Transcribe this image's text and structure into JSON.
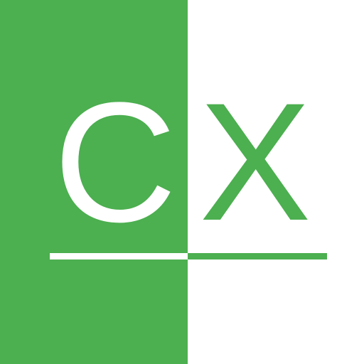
{
  "logo": {
    "letter_left": "C",
    "letter_right": "X"
  },
  "colors": {
    "brand_green": "#4caf50",
    "white": "#ffffff"
  }
}
